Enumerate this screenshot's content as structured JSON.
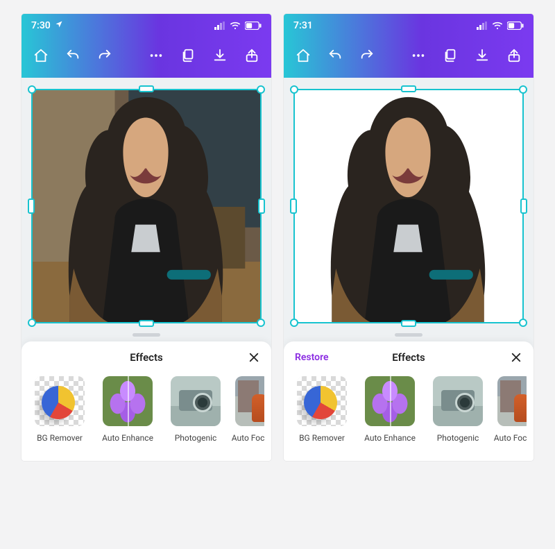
{
  "screens": [
    {
      "status": {
        "time": "7:30",
        "location_arrow": true
      },
      "toolbar_icons": {
        "home": "home-icon",
        "undo": "undo-icon",
        "redo": "redo-icon",
        "more": "more-icon",
        "layers": "layers-icon",
        "download": "download-icon",
        "share": "share-icon"
      },
      "canvas": {
        "background_removed": false
      },
      "panel": {
        "left_action": "",
        "title": "Effects",
        "effects": [
          {
            "id": "bg-remover",
            "label": "BG Remover"
          },
          {
            "id": "auto-enhance",
            "label": "Auto Enhance"
          },
          {
            "id": "photogenic",
            "label": "Photogenic"
          },
          {
            "id": "auto-focus",
            "label": "Auto Focus"
          }
        ]
      }
    },
    {
      "status": {
        "time": "7:31",
        "location_arrow": false
      },
      "toolbar_icons": {
        "home": "home-icon",
        "undo": "undo-icon",
        "redo": "redo-icon",
        "more": "more-icon",
        "layers": "layers-icon",
        "download": "download-icon",
        "share": "share-icon"
      },
      "canvas": {
        "background_removed": true
      },
      "panel": {
        "left_action": "Restore",
        "title": "Effects",
        "effects": [
          {
            "id": "bg-remover",
            "label": "BG Remover"
          },
          {
            "id": "auto-enhance",
            "label": "Auto Enhance"
          },
          {
            "id": "photogenic",
            "label": "Photogenic"
          },
          {
            "id": "auto-focus",
            "label": "Auto Focus"
          }
        ]
      }
    }
  ],
  "colors": {
    "gradient_start": "#28c6d6",
    "gradient_end": "#7b3af0",
    "selection": "#17c3cf",
    "accent": "#8a2be2"
  }
}
